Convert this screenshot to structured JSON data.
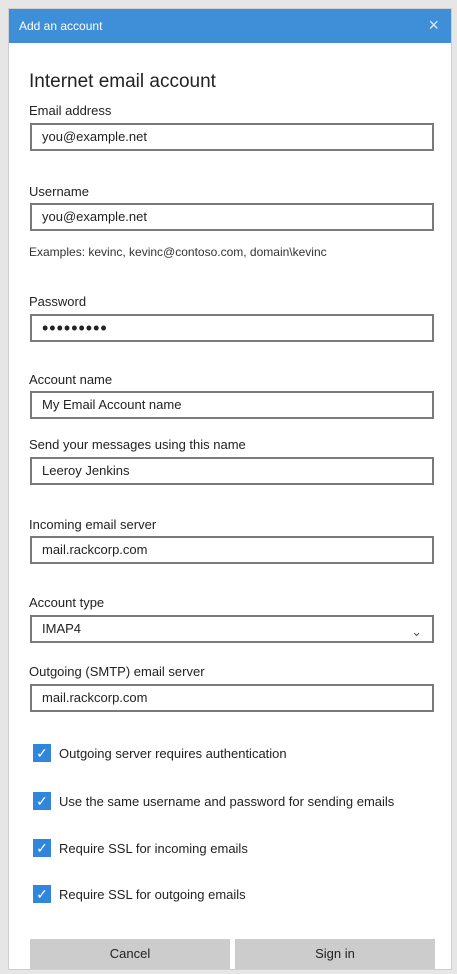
{
  "window": {
    "title": "Add an account",
    "close_icon": "×"
  },
  "heading": "Internet email account",
  "fields": {
    "email": {
      "label": "Email address",
      "value": "you@example.net"
    },
    "username": {
      "label": "Username",
      "value": "you@example.net",
      "hint": "Examples: kevinc, kevinc@contoso.com, domain\\kevinc"
    },
    "password": {
      "label": "Password",
      "value": "•••••••••"
    },
    "account_name": {
      "label": "Account name",
      "value": "My Email Account name"
    },
    "display_name": {
      "label": "Send your messages using this name",
      "value": "Leeroy Jenkins"
    },
    "incoming": {
      "label": "Incoming email server",
      "value": "mail.rackcorp.com"
    },
    "account_type": {
      "label": "Account type",
      "value": "IMAP4"
    },
    "outgoing": {
      "label": "Outgoing (SMTP) email server",
      "value": "mail.rackcorp.com"
    }
  },
  "checkboxes": [
    {
      "label": "Outgoing server requires authentication",
      "checked": true
    },
    {
      "label": "Use the same username and password for sending emails",
      "checked": true
    },
    {
      "label": "Require SSL for incoming emails",
      "checked": true
    },
    {
      "label": "Require SSL for outgoing emails",
      "checked": true
    }
  ],
  "buttons": {
    "cancel": "Cancel",
    "sign_in": "Sign in"
  },
  "colors": {
    "titlebar": "#3f8fd8",
    "checkbox": "#2f86dc",
    "button": "#cccccc"
  }
}
